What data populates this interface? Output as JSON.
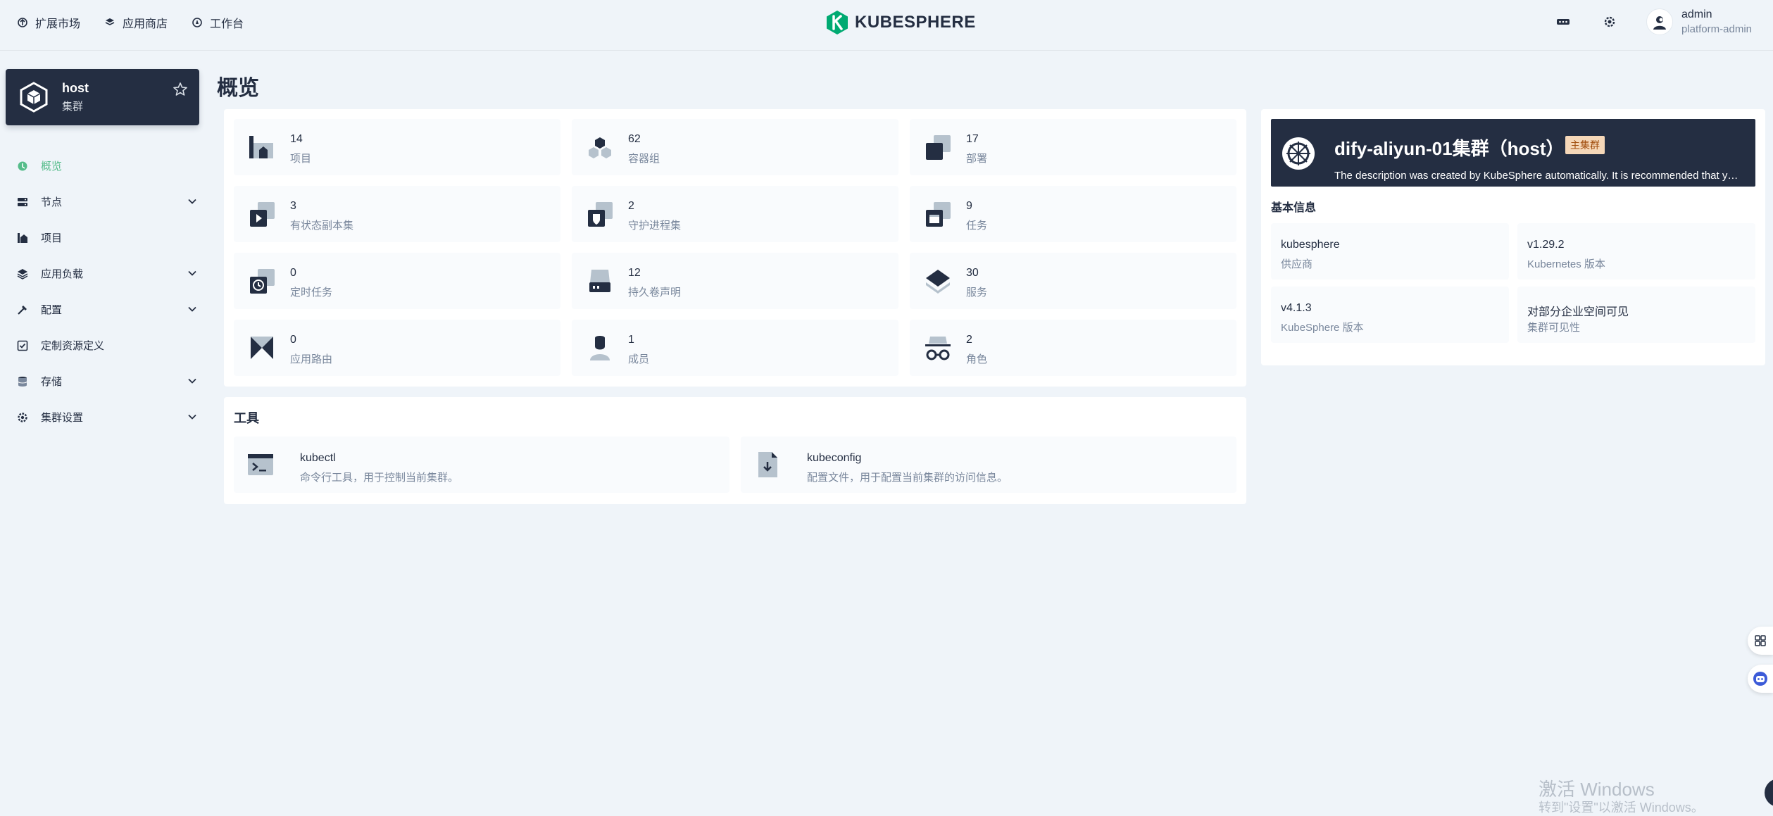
{
  "topnav": {
    "items": [
      {
        "label": "扩展市场",
        "icon": "extension-icon"
      },
      {
        "label": "应用商店",
        "icon": "appstore-icon"
      },
      {
        "label": "工作台",
        "icon": "workbench-icon"
      }
    ]
  },
  "brand": {
    "name": "KUBESPHERE",
    "color": "#00aa72"
  },
  "user": {
    "name": "admin",
    "role": "platform-admin"
  },
  "cluster": {
    "name": "host",
    "type": "集群"
  },
  "sidebar": {
    "items": [
      {
        "label": "概览",
        "active": true,
        "expandable": false,
        "icon": "dashboard-icon"
      },
      {
        "label": "节点",
        "active": false,
        "expandable": true,
        "icon": "nodes-icon"
      },
      {
        "label": "项目",
        "active": false,
        "expandable": false,
        "icon": "project-icon"
      },
      {
        "label": "应用负载",
        "active": false,
        "expandable": true,
        "icon": "workload-icon"
      },
      {
        "label": "配置",
        "active": false,
        "expandable": true,
        "icon": "config-icon"
      },
      {
        "label": "定制资源定义",
        "active": false,
        "expandable": false,
        "icon": "crd-icon"
      },
      {
        "label": "存储",
        "active": false,
        "expandable": true,
        "icon": "storage-icon"
      },
      {
        "label": "集群设置",
        "active": false,
        "expandable": true,
        "icon": "cluster-settings-icon"
      }
    ]
  },
  "page": {
    "title": "概览"
  },
  "stats": [
    {
      "value": "14",
      "label": "项目",
      "icon": "project-icon"
    },
    {
      "value": "62",
      "label": "容器组",
      "icon": "pods-icon"
    },
    {
      "value": "17",
      "label": "部署",
      "icon": "deployment-icon"
    },
    {
      "value": "3",
      "label": "有状态副本集",
      "icon": "statefulset-icon"
    },
    {
      "value": "2",
      "label": "守护进程集",
      "icon": "daemonset-icon"
    },
    {
      "value": "9",
      "label": "任务",
      "icon": "job-icon"
    },
    {
      "value": "0",
      "label": "定时任务",
      "icon": "cronjob-icon"
    },
    {
      "value": "12",
      "label": "持久卷声明",
      "icon": "pvc-icon"
    },
    {
      "value": "30",
      "label": "服务",
      "icon": "service-icon"
    },
    {
      "value": "0",
      "label": "应用路由",
      "icon": "ingress-icon"
    },
    {
      "value": "1",
      "label": "成员",
      "icon": "member-icon"
    },
    {
      "value": "2",
      "label": "角色",
      "icon": "role-icon"
    }
  ],
  "tools": {
    "title": "工具",
    "items": [
      {
        "name": "kubectl",
        "desc": "命令行工具，用于控制当前集群。",
        "icon": "terminal-icon"
      },
      {
        "name": "kubeconfig",
        "desc": "配置文件，用于配置当前集群的访问信息。",
        "icon": "download-file-icon"
      }
    ]
  },
  "cluster_info": {
    "title": "dify-aliyun-01集群（host）",
    "badge": "主集群",
    "description": "The description was created by KubeSphere automatically. It is recommended that you...",
    "section_title": "基本信息",
    "fields": [
      {
        "value": "kubesphere",
        "label": "供应商"
      },
      {
        "value": "v1.29.2",
        "label": "Kubernetes 版本"
      },
      {
        "value": "v4.1.3",
        "label": "KubeSphere 版本"
      },
      {
        "value": "对部分企业空间可见",
        "label": "集群可见性"
      }
    ]
  },
  "watermark": {
    "line1": "激活 Windows",
    "line2": "转到\"设置\"以激活 Windows。"
  },
  "colors": {
    "accent": "#55bc8a",
    "dark": "#242e42",
    "muted": "#79879c",
    "background": "#eff4f9"
  }
}
